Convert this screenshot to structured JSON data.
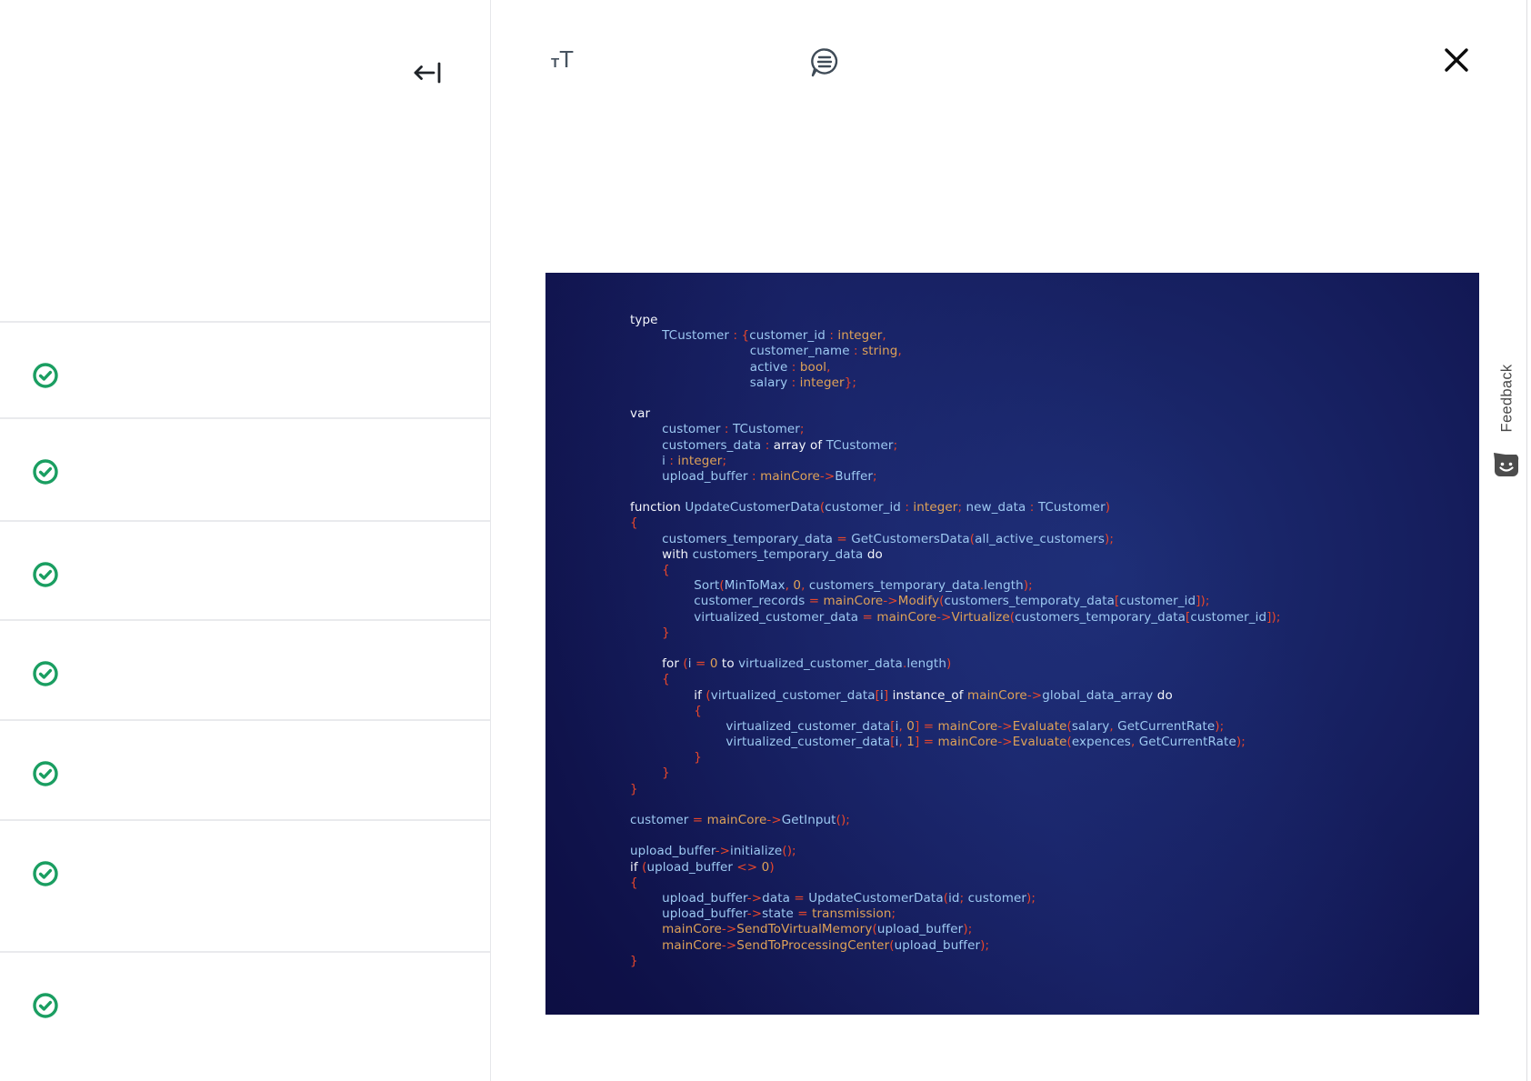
{
  "toolbar": {
    "back_icon": "arrow-left-to-bar",
    "text_size_icon": {
      "small": "T",
      "large": "T"
    },
    "transcript_icon": "speech-bubble-with-lines",
    "close_icon": "x-close"
  },
  "sidebar": {
    "items": [
      {
        "icon": "check-circle",
        "status": "completed"
      },
      {
        "icon": "check-circle",
        "status": "completed"
      },
      {
        "icon": "check-circle",
        "status": "completed"
      },
      {
        "icon": "check-circle",
        "status": "completed"
      },
      {
        "icon": "check-circle",
        "status": "completed"
      },
      {
        "icon": "check-circle",
        "status": "completed"
      },
      {
        "icon": "check-circle",
        "status": "completed"
      }
    ]
  },
  "feedback": {
    "label": "Feedback",
    "icon": "smiley-chat-bubble"
  },
  "colors": {
    "check_green": "#1a9e61",
    "panel_navy": "#0a0a38",
    "code_white": "#f4f6fb",
    "code_blue": "#9dc9f2",
    "code_orange": "#dfa258",
    "code_red": "#e8472b"
  },
  "code_panel": {
    "lines": [
      [
        [
          "w",
          "type"
        ]
      ],
      [
        [
          "b",
          "        TCustomer"
        ],
        [
          "r",
          " : {"
        ],
        [
          "b",
          "customer_id"
        ],
        [
          "r",
          " : "
        ],
        [
          "o",
          "integer"
        ],
        [
          "r",
          ","
        ]
      ],
      [
        [
          "b",
          "                              customer_name"
        ],
        [
          "r",
          " : "
        ],
        [
          "o",
          "string"
        ],
        [
          "r",
          ","
        ]
      ],
      [
        [
          "b",
          "                              active"
        ],
        [
          "r",
          " : "
        ],
        [
          "o",
          "bool"
        ],
        [
          "r",
          ","
        ]
      ],
      [
        [
          "b",
          "                              salary"
        ],
        [
          "r",
          " : "
        ],
        [
          "o",
          "integer"
        ],
        [
          "r",
          "};"
        ]
      ],
      [],
      [
        [
          "w",
          "var"
        ]
      ],
      [
        [
          "b",
          "        customer"
        ],
        [
          "r",
          " : "
        ],
        [
          "b",
          "TCustomer"
        ],
        [
          "r",
          ";"
        ]
      ],
      [
        [
          "b",
          "        customers_data"
        ],
        [
          "r",
          " : "
        ],
        [
          "w",
          "array of "
        ],
        [
          "b",
          "TCustomer"
        ],
        [
          "r",
          ";"
        ]
      ],
      [
        [
          "b",
          "        i"
        ],
        [
          "r",
          " : "
        ],
        [
          "o",
          "integer"
        ],
        [
          "r",
          ";"
        ]
      ],
      [
        [
          "b",
          "        upload_buffer"
        ],
        [
          "r",
          " : "
        ],
        [
          "o",
          "mainCore"
        ],
        [
          "r",
          "->"
        ],
        [
          "b",
          "Buffer"
        ],
        [
          "r",
          ";"
        ]
      ],
      [],
      [
        [
          "w",
          "function "
        ],
        [
          "b",
          "UpdateCustomerData"
        ],
        [
          "r",
          "("
        ],
        [
          "b",
          "customer_id"
        ],
        [
          "r",
          " : "
        ],
        [
          "o",
          "integer"
        ],
        [
          "r",
          "; "
        ],
        [
          "b",
          "new_data"
        ],
        [
          "r",
          " : "
        ],
        [
          "b",
          "TCustomer"
        ],
        [
          "r",
          ")"
        ]
      ],
      [
        [
          "r",
          "{"
        ]
      ],
      [
        [
          "b",
          "        customers_temporary_data"
        ],
        [
          "r",
          " = "
        ],
        [
          "b",
          "GetCustomersData"
        ],
        [
          "r",
          "("
        ],
        [
          "b",
          "all_active_customers"
        ],
        [
          "r",
          ");"
        ]
      ],
      [
        [
          "w",
          "        with "
        ],
        [
          "b",
          "customers_temporary_data"
        ],
        [
          "w",
          " do"
        ]
      ],
      [
        [
          "r",
          "        {"
        ]
      ],
      [
        [
          "b",
          "                Sort"
        ],
        [
          "r",
          "("
        ],
        [
          "b",
          "MinToMax"
        ],
        [
          "r",
          ", "
        ],
        [
          "o",
          "0"
        ],
        [
          "r",
          ", "
        ],
        [
          "b",
          "customers_temporary_data"
        ],
        [
          "r",
          "."
        ],
        [
          "b",
          "length"
        ],
        [
          "r",
          ");"
        ]
      ],
      [
        [
          "b",
          "                customer_records"
        ],
        [
          "r",
          " = "
        ],
        [
          "o",
          "mainCore"
        ],
        [
          "r",
          "->"
        ],
        [
          "o",
          "Modify"
        ],
        [
          "r",
          "("
        ],
        [
          "b",
          "customers_temporaty_data"
        ],
        [
          "r",
          "["
        ],
        [
          "b",
          "customer_id"
        ],
        [
          "r",
          "]);"
        ]
      ],
      [
        [
          "b",
          "                virtualized_customer_data"
        ],
        [
          "r",
          " = "
        ],
        [
          "o",
          "mainCore"
        ],
        [
          "r",
          "->"
        ],
        [
          "o",
          "Virtualize"
        ],
        [
          "r",
          "("
        ],
        [
          "b",
          "customers_temporary_data"
        ],
        [
          "r",
          "["
        ],
        [
          "b",
          "customer_id"
        ],
        [
          "r",
          "]);"
        ]
      ],
      [
        [
          "r",
          "        }"
        ]
      ],
      [],
      [
        [
          "w",
          "        for "
        ],
        [
          "r",
          "("
        ],
        [
          "b",
          "i"
        ],
        [
          "r",
          " = "
        ],
        [
          "o",
          "0"
        ],
        [
          "w",
          " to "
        ],
        [
          "b",
          "virtualized_customer_data"
        ],
        [
          "r",
          "."
        ],
        [
          "b",
          "length"
        ],
        [
          "r",
          ")"
        ]
      ],
      [
        [
          "r",
          "        {"
        ]
      ],
      [
        [
          "w",
          "                if "
        ],
        [
          "r",
          "("
        ],
        [
          "b",
          "virtualized_customer_data"
        ],
        [
          "r",
          "["
        ],
        [
          "b",
          "i"
        ],
        [
          "r",
          "] "
        ],
        [
          "w",
          "instance_of "
        ],
        [
          "o",
          "mainCore"
        ],
        [
          "r",
          "->"
        ],
        [
          "b",
          "global_data_array"
        ],
        [
          "w",
          " do"
        ]
      ],
      [
        [
          "r",
          "                {"
        ]
      ],
      [
        [
          "b",
          "                        virtualized_customer_data"
        ],
        [
          "r",
          "["
        ],
        [
          "b",
          "i"
        ],
        [
          "r",
          ", "
        ],
        [
          "o",
          "0"
        ],
        [
          "r",
          "] = "
        ],
        [
          "o",
          "mainCore"
        ],
        [
          "r",
          "->"
        ],
        [
          "o",
          "Evaluate"
        ],
        [
          "r",
          "("
        ],
        [
          "b",
          "salary"
        ],
        [
          "r",
          ", "
        ],
        [
          "b",
          "GetCurrentRate"
        ],
        [
          "r",
          ");"
        ]
      ],
      [
        [
          "b",
          "                        virtualized_customer_data"
        ],
        [
          "r",
          "["
        ],
        [
          "b",
          "i"
        ],
        [
          "r",
          ", "
        ],
        [
          "o",
          "1"
        ],
        [
          "r",
          "] = "
        ],
        [
          "o",
          "mainCore"
        ],
        [
          "r",
          "->"
        ],
        [
          "o",
          "Evaluate"
        ],
        [
          "r",
          "("
        ],
        [
          "b",
          "expences"
        ],
        [
          "r",
          ", "
        ],
        [
          "b",
          "GetCurrentRate"
        ],
        [
          "r",
          ");"
        ]
      ],
      [
        [
          "r",
          "                }"
        ]
      ],
      [
        [
          "r",
          "        }"
        ]
      ],
      [
        [
          "r",
          "}"
        ]
      ],
      [],
      [
        [
          "b",
          "customer"
        ],
        [
          "r",
          " = "
        ],
        [
          "o",
          "mainCore"
        ],
        [
          "r",
          "->"
        ],
        [
          "b",
          "GetInput"
        ],
        [
          "r",
          "();"
        ]
      ],
      [],
      [
        [
          "b",
          "upload_buffer"
        ],
        [
          "r",
          "->"
        ],
        [
          "b",
          "initialize"
        ],
        [
          "r",
          "();"
        ]
      ],
      [
        [
          "w",
          "if "
        ],
        [
          "r",
          "("
        ],
        [
          "b",
          "upload_buffer"
        ],
        [
          "r",
          " <> "
        ],
        [
          "o",
          "0"
        ],
        [
          "r",
          ")"
        ]
      ],
      [
        [
          "r",
          "{"
        ]
      ],
      [
        [
          "b",
          "        upload_buffer"
        ],
        [
          "r",
          "->"
        ],
        [
          "b",
          "data"
        ],
        [
          "r",
          " = "
        ],
        [
          "b",
          "UpdateCustomerData"
        ],
        [
          "r",
          "("
        ],
        [
          "b",
          "id"
        ],
        [
          "r",
          "; "
        ],
        [
          "b",
          "customer"
        ],
        [
          "r",
          ");"
        ]
      ],
      [
        [
          "b",
          "        upload_buffer"
        ],
        [
          "r",
          "->"
        ],
        [
          "b",
          "state"
        ],
        [
          "r",
          " = "
        ],
        [
          "o",
          "transmission"
        ],
        [
          "r",
          ";"
        ]
      ],
      [
        [
          "o",
          "        mainCore"
        ],
        [
          "r",
          "->"
        ],
        [
          "o",
          "SendToVirtualMemory"
        ],
        [
          "r",
          "("
        ],
        [
          "b",
          "upload_buffer"
        ],
        [
          "r",
          ");"
        ]
      ],
      [
        [
          "o",
          "        mainCore"
        ],
        [
          "r",
          "->"
        ],
        [
          "o",
          "SendToProcessingCenter"
        ],
        [
          "r",
          "("
        ],
        [
          "b",
          "upload_buffer"
        ],
        [
          "r",
          ");"
        ]
      ],
      [
        [
          "r",
          "}"
        ]
      ]
    ]
  }
}
